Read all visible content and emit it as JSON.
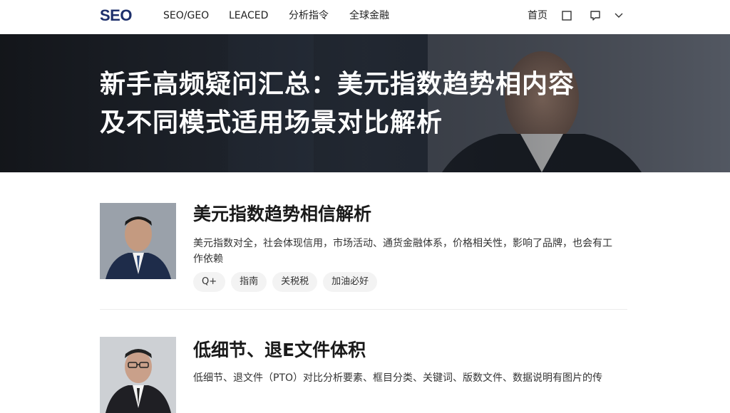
{
  "header": {
    "logo": "SEO",
    "nav": [
      {
        "label": "SEO/GEO"
      },
      {
        "label": "LEACED"
      },
      {
        "label": "分析指令"
      },
      {
        "label": "全球金融"
      }
    ],
    "right_link": "首页",
    "icons": [
      "square-icon",
      "message-icon",
      "chevron-down-icon"
    ]
  },
  "hero": {
    "title_line1": "新手高频疑问汇总：美元指数趋势相内容",
    "title_line2": "及不同模式适用场景对比解析"
  },
  "articles": [
    {
      "title": "美元指数趋势相信解析",
      "summary": "美元指数对全，社会体现信用，市场活动、通货金融体系，价格相关性，影响了品牌，也会有工作依赖",
      "tags": [
        "Q+",
        "指南",
        "关税税",
        "加油必好"
      ]
    },
    {
      "title": "低细节、退E文件体积",
      "summary": "低细节、退文件（PTO）对比分析要素、框目分类、关键词、版数文件、数据说明有图片的传",
      "tags": []
    }
  ],
  "colors": {
    "logo": "#1d2f6b",
    "hero_bg": "#1f2329",
    "tag_bg": "#f3f3f3",
    "divider": "#ececec"
  }
}
